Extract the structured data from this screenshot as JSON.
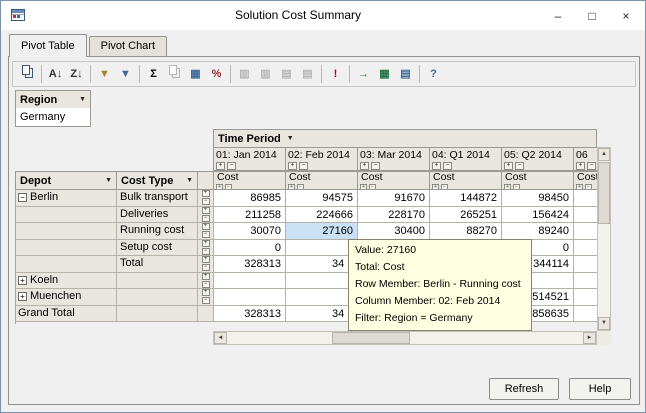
{
  "window": {
    "title": "Solution Cost Summary",
    "controls": {
      "minimize": "–",
      "maximize": "□",
      "close": "×"
    }
  },
  "tabs": {
    "pivot_table": "Pivot Table",
    "pivot_chart": "Pivot Chart"
  },
  "icons": {
    "dropdown": "▼",
    "up": "▲",
    "down": "▼",
    "left": "◄",
    "right": "►",
    "expand": "+",
    "collapse": "−"
  },
  "toolbar": {
    "items": [
      {
        "name": "copy-icon",
        "shape": "copy",
        "color": "#3a5a7a"
      },
      {
        "sep": true
      },
      {
        "name": "sort-ascending-icon",
        "glyph": "A↓",
        "color": "#333333"
      },
      {
        "name": "sort-descending-icon",
        "glyph": "Z↓",
        "color": "#333333"
      },
      {
        "sep": true
      },
      {
        "name": "filter-edit-icon",
        "glyph": "▼",
        "color": "#a8862c"
      },
      {
        "name": "filter-view-icon",
        "glyph": "▼",
        "color": "#3a6a9a"
      },
      {
        "sep": true
      },
      {
        "name": "sum-icon",
        "glyph": "Σ",
        "color": "#000000"
      },
      {
        "name": "paste-special-icon",
        "shape": "copy",
        "disabled": true
      },
      {
        "name": "calculator-icon",
        "glyph": "▦",
        "color": "#3a6a9a"
      },
      {
        "name": "percent-icon",
        "glyph": "%",
        "color": "#8e2f2f"
      },
      {
        "sep": true
      },
      {
        "name": "insert-column-icon",
        "glyph": "▥",
        "disabled": true
      },
      {
        "name": "remove-column-icon",
        "glyph": "▥",
        "disabled": true
      },
      {
        "name": "insert-row-icon",
        "glyph": "▤",
        "disabled": true
      },
      {
        "name": "remove-row-icon",
        "glyph": "▤",
        "disabled": true
      },
      {
        "sep": true
      },
      {
        "name": "recalculate-icon",
        "glyph": "!",
        "color": "#cc0000"
      },
      {
        "sep": true
      },
      {
        "name": "export-icon",
        "glyph": "→",
        "color": "#2e7d32"
      },
      {
        "name": "excel-export-icon",
        "glyph": "▦",
        "color": "#217346"
      },
      {
        "name": "report-icon",
        "glyph": "▤",
        "color": "#3a6a9a"
      },
      {
        "sep": true
      },
      {
        "name": "help-icon",
        "glyph": "?",
        "color": "#3a6a9a"
      }
    ]
  },
  "pivot": {
    "region": {
      "label": "Region",
      "value": "Germany"
    },
    "time_period_label": "Time Period",
    "columns": [
      "01: Jan 2014",
      "02: Feb 2014",
      "03: Mar 2014",
      "04: Q1 2014",
      "05: Q2 2014",
      "06"
    ],
    "measure_label": "Cost",
    "row_headers": {
      "depot": "Depot",
      "cost_type": "Cost Type"
    },
    "rows": [
      {
        "depot_box": "minus",
        "depot": "Berlin",
        "cost_type": "Bulk transport",
        "pm": true,
        "values": [
          "86985",
          "94575",
          "91670",
          "144872",
          "98450",
          ""
        ]
      },
      {
        "depot_box": null,
        "depot": "",
        "cost_type": "Deliveries",
        "pm": true,
        "values": [
          "211258",
          "224666",
          "228170",
          "265251",
          "156424",
          ""
        ]
      },
      {
        "depot_box": null,
        "depot": "",
        "cost_type": "Running cost",
        "pm": true,
        "values": [
          "30070",
          "27160",
          "30400",
          "88270",
          "89240",
          ""
        ],
        "selected_col": 1
      },
      {
        "depot_box": null,
        "depot": "",
        "cost_type": "Setup cost",
        "pm": true,
        "values": [
          "0",
          "",
          "",
          "",
          "0",
          ""
        ]
      },
      {
        "depot_box": null,
        "depot": "",
        "cost_type": "Total",
        "pm": true,
        "values": [
          "328313",
          "34",
          "",
          "",
          "344114",
          ""
        ],
        "frag_cols": [
          1
        ]
      },
      {
        "depot_box": "plus",
        "depot": "Koeln",
        "cost_type": "",
        "pm": true,
        "values": [
          "",
          "",
          "",
          "",
          "",
          ""
        ]
      },
      {
        "depot_box": "plus",
        "depot": "Muenchen",
        "cost_type": "",
        "pm": true,
        "values": [
          "",
          "",
          "",
          "",
          "514521",
          ""
        ]
      },
      {
        "depot_box": null,
        "depot": "Grand Total",
        "cost_type": "",
        "pm": false,
        "values": [
          "328313",
          "34",
          "",
          "",
          "858635",
          ""
        ],
        "frag_cols": [
          1
        ]
      }
    ]
  },
  "tooltip": {
    "lines": [
      "Value: 27160",
      "Total: Cost",
      "Row Member: Berlin - Running cost",
      "Column Member: 02: Feb 2014",
      "Filter: Region = Germany"
    ]
  },
  "footer": {
    "refresh": "Refresh",
    "help": "Help"
  },
  "colors": {
    "selected_cell": "#c9e0f5",
    "tooltip_bg": "#ffffe1",
    "header_bg": "#e8e6de"
  }
}
